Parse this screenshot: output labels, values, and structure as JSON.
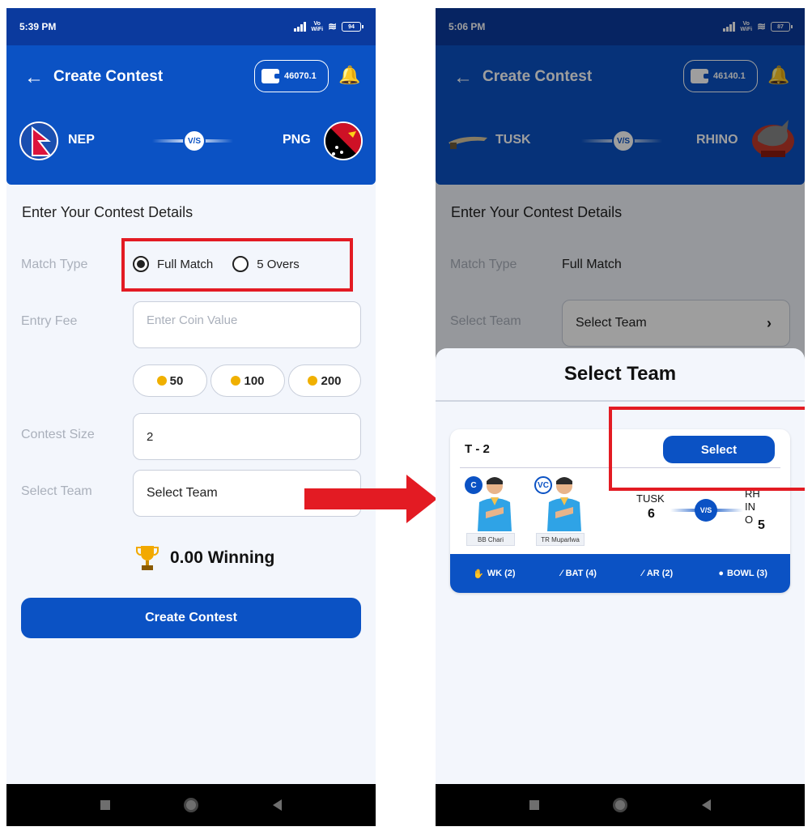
{
  "left": {
    "status": {
      "time": "5:39 PM",
      "battery": "94"
    },
    "appbar": {
      "title": "Create Contest",
      "wallet": "46070.1"
    },
    "match": {
      "team1": "NEP",
      "team2": "PNG",
      "vs": "V/S"
    },
    "section_title": "Enter Your Contest Details",
    "match_type": {
      "label": "Match Type",
      "options": [
        "Full Match",
        "5 Overs"
      ],
      "selected": "Full Match"
    },
    "entry_fee": {
      "label": "Entry Fee",
      "placeholder": "Enter Coin Value"
    },
    "chips": [
      "50",
      "100",
      "200"
    ],
    "contest_size": {
      "label": "Contest Size",
      "value": "2"
    },
    "select_team": {
      "label": "Select Team",
      "value": "Select Team"
    },
    "winning": "0.00 Winning",
    "create_button": "Create Contest"
  },
  "right": {
    "status": {
      "time": "5:06 PM",
      "battery": "87"
    },
    "appbar": {
      "title": "Create Contest",
      "wallet": "46140.1"
    },
    "match": {
      "team1": "TUSK",
      "team2": "RHINO",
      "vs": "V/S"
    },
    "section_title": "Enter Your Contest Details",
    "match_type": {
      "label": "Match Type",
      "value": "Full Match"
    },
    "select_team": {
      "label": "Select Team",
      "value": "Select Team"
    },
    "sheet": {
      "title": "Select Team",
      "team_name": "T - 2",
      "select_button": "Select",
      "captain": {
        "badge": "C",
        "name": "BB Chari"
      },
      "vice_captain": {
        "badge": "VC",
        "name": "TR Muparlwa"
      },
      "score": {
        "team1": "TUSK",
        "team1_count": "6",
        "team2": "RHINO",
        "team2_count": "5",
        "vs": "V/S"
      },
      "roles": [
        "WK (2)",
        "BAT (4)",
        "AR (2)",
        "BOWL (3)"
      ]
    }
  },
  "colors": {
    "primary": "#0b52c4",
    "status_bar": "#0b3a9e",
    "highlight": "#e31b23"
  }
}
